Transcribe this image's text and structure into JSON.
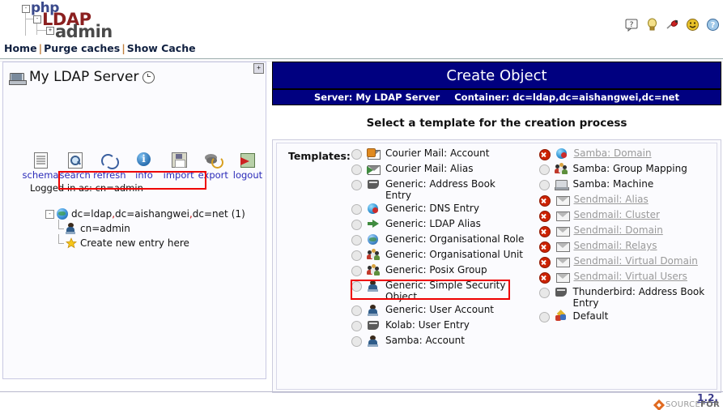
{
  "logo": {
    "line1": "php",
    "line2": "LDAP",
    "line3": "admin",
    "box1": "-",
    "box2": "-",
    "box3": "+"
  },
  "top_icons": [
    {
      "name": "help-bubble-icon",
      "label": "?"
    },
    {
      "name": "lightbulb-icon",
      "label": ""
    },
    {
      "name": "bug-icon",
      "label": ""
    },
    {
      "name": "smiley-icon",
      "label": ""
    },
    {
      "name": "question-circle-icon",
      "label": "?"
    }
  ],
  "navbar": {
    "home": "Home",
    "purge": "Purge caches",
    "show_cache": "Show Cache",
    "separator": "|"
  },
  "sidebar": {
    "expand_button": "+",
    "server_name": "My LDAP Server",
    "toolbar": [
      {
        "label": "schema",
        "icon": "schema-icon"
      },
      {
        "label": "search",
        "icon": "search-icon"
      },
      {
        "label": "refresh",
        "icon": "refresh-icon"
      },
      {
        "label": "info",
        "icon": "info-icon"
      },
      {
        "label": "import",
        "icon": "import-icon"
      },
      {
        "label": "export",
        "icon": "export-icon"
      },
      {
        "label": "logout",
        "icon": "logout-icon"
      }
    ],
    "logged_in_as": "Logged in as: cn=admin",
    "tree": {
      "root_toggle": "-",
      "root_parts": [
        "dc=ldap",
        "dc=aishangwei",
        "dc=net"
      ],
      "root_count": "(1)",
      "child": "cn=admin",
      "create_entry": "Create new entry here"
    }
  },
  "main": {
    "title": "Create Object",
    "server_label": "Server:",
    "server_value": "My LDAP Server",
    "container_label": "Container:",
    "container_value": "dc=ldap,dc=aishangwei,dc=net",
    "subtitle": "Select a template for the creation process",
    "templates_label": "Templates:",
    "left_column": [
      {
        "label": "Courier Mail: Account",
        "icon": "mail-account-icon",
        "state": "enabled"
      },
      {
        "label": "Courier Mail: Alias",
        "icon": "mail-alias-icon",
        "state": "enabled"
      },
      {
        "label": "Generic: Address Book Entry",
        "icon": "address-book-icon",
        "state": "enabled"
      },
      {
        "label": "Generic: DNS Entry",
        "icon": "dns-icon",
        "state": "enabled"
      },
      {
        "label": "Generic: LDAP Alias",
        "icon": "green-arrow-icon",
        "state": "enabled"
      },
      {
        "label": "Generic: Organisational Role",
        "icon": "globe-icon",
        "state": "enabled"
      },
      {
        "label": "Generic: Organisational Unit",
        "icon": "group-icon",
        "state": "enabled"
      },
      {
        "label": "Generic: Posix Group",
        "icon": "group-icon",
        "state": "enabled",
        "highlighted": true
      },
      {
        "label": "Generic: Simple Security Object",
        "icon": "person-icon",
        "state": "enabled"
      },
      {
        "label": "Generic: User Account",
        "icon": "person-icon",
        "state": "enabled"
      },
      {
        "label": "Kolab: User Entry",
        "icon": "address-book-icon",
        "state": "enabled"
      },
      {
        "label": "Samba: Account",
        "icon": "person-icon",
        "state": "enabled"
      }
    ],
    "right_column": [
      {
        "label": "Samba: Domain",
        "icon": "dns-icon",
        "state": "disabled"
      },
      {
        "label": "Samba: Group Mapping",
        "icon": "group-icon",
        "state": "enabled"
      },
      {
        "label": "Samba: Machine",
        "icon": "computer-icon",
        "state": "enabled"
      },
      {
        "label": "Sendmail: Alias",
        "icon": "envelope-icon",
        "state": "disabled"
      },
      {
        "label": "Sendmail: Cluster",
        "icon": "envelope-icon",
        "state": "disabled"
      },
      {
        "label": "Sendmail: Domain",
        "icon": "envelope-icon",
        "state": "disabled"
      },
      {
        "label": "Sendmail: Relays",
        "icon": "envelope-icon",
        "state": "disabled"
      },
      {
        "label": "Sendmail: Virtual Domain",
        "icon": "envelope-icon",
        "state": "disabled"
      },
      {
        "label": "Sendmail: Virtual Users",
        "icon": "envelope-icon",
        "state": "disabled"
      },
      {
        "label": "Thunderbird: Address Book Entry",
        "icon": "address-book-icon",
        "state": "enabled"
      },
      {
        "label": "Default",
        "icon": "cubes-icon",
        "state": "enabled"
      }
    ]
  },
  "footer": {
    "version": "1.2.",
    "sourceforge_prefix": "SOURCE",
    "sourceforge_suffix": "FOR"
  },
  "colors": {
    "header_blue": "#000080",
    "highlight_red": "#ee0000",
    "link_blue": "#2a2ab8",
    "panel_border": "#ccccdd"
  }
}
